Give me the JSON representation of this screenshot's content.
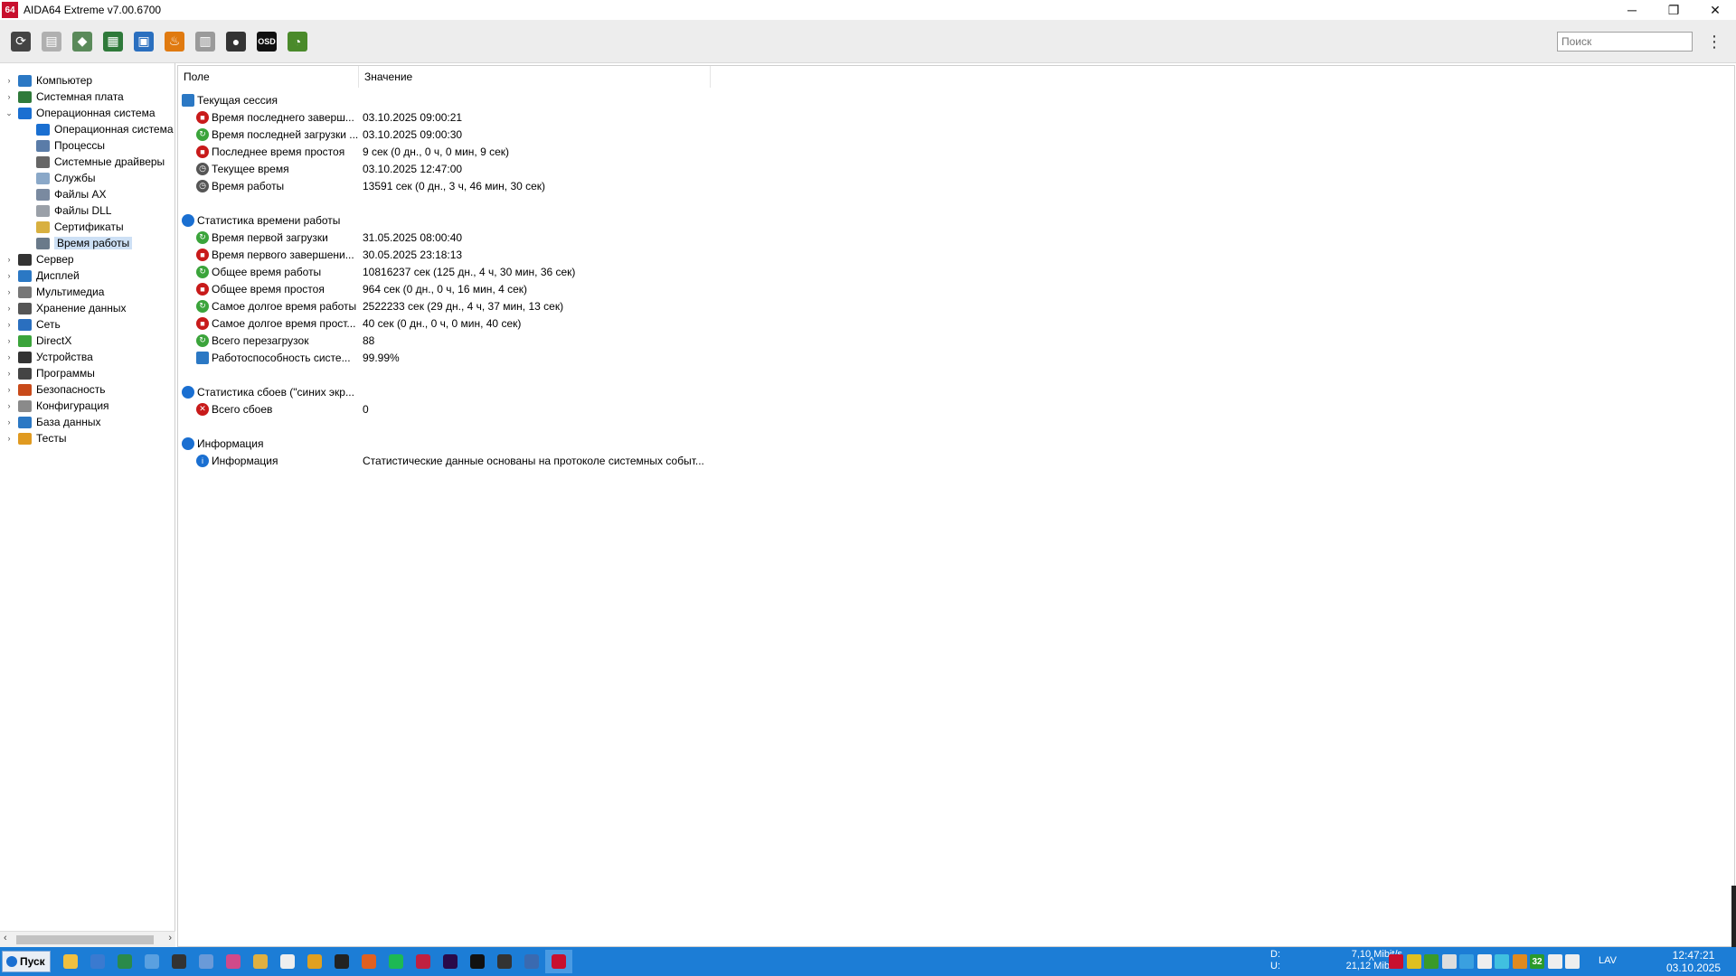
{
  "window": {
    "icon_text": "64",
    "title": "AIDA64 Extreme v7.00.6700",
    "min": "─",
    "restore": "❐",
    "close": "✕"
  },
  "toolbar": {
    "search_placeholder": "Поиск",
    "menu": "⋮",
    "buttons": [
      {
        "name": "refresh-icon",
        "glyph": "⟳",
        "color": "#444444"
      },
      {
        "name": "report-icon",
        "glyph": "▤",
        "color": "#b0b0b0"
      },
      {
        "name": "motherboard-icon",
        "glyph": "◆",
        "color": "#5a8a5a"
      },
      {
        "name": "memory-icon",
        "glyph": "▦",
        "color": "#2f7a3a"
      },
      {
        "name": "network-icon",
        "glyph": "▣",
        "color": "#2a6fbf"
      },
      {
        "name": "flame-icon",
        "glyph": "♨",
        "color": "#e07a10"
      },
      {
        "name": "benchmark-icon",
        "glyph": "▥",
        "color": "#9a9a9a"
      },
      {
        "name": "user-icon",
        "glyph": "●",
        "color": "#333333"
      },
      {
        "name": "osd-icon",
        "glyph": "OSD",
        "color": "#111111"
      },
      {
        "name": "gauge-icon",
        "glyph": "◔",
        "color": "#4a8a2a"
      }
    ]
  },
  "tree": {
    "items": [
      {
        "label": "Компьютер",
        "arrow": "›",
        "level": 0,
        "color": "#2b78c4",
        "icon": "computer-icon"
      },
      {
        "label": "Системная плата",
        "arrow": "›",
        "level": 0,
        "color": "#2f7a3a",
        "icon": "motherboard-icon"
      },
      {
        "label": "Операционная система",
        "arrow": "⌄",
        "level": 0,
        "color": "#1a6fd1",
        "icon": "windows-icon"
      },
      {
        "label": "Операционная система",
        "arrow": "",
        "level": 1,
        "color": "#1a6fd1",
        "icon": "windows-icon"
      },
      {
        "label": "Процессы",
        "arrow": "",
        "level": 1,
        "color": "#5a7ca8",
        "icon": "process-icon"
      },
      {
        "label": "Системные драйверы",
        "arrow": "",
        "level": 1,
        "color": "#666666",
        "icon": "driver-icon"
      },
      {
        "label": "Службы",
        "arrow": "",
        "level": 1,
        "color": "#8aa8c8",
        "icon": "services-icon"
      },
      {
        "label": "Файлы AX",
        "arrow": "",
        "level": 1,
        "color": "#7a8aa0",
        "icon": "ax-file-icon"
      },
      {
        "label": "Файлы DLL",
        "arrow": "",
        "level": 1,
        "color": "#9aa0a8",
        "icon": "dll-file-icon"
      },
      {
        "label": "Сертификаты",
        "arrow": "",
        "level": 1,
        "color": "#d8b040",
        "icon": "certificate-icon"
      },
      {
        "label": "Время работы",
        "arrow": "",
        "level": 1,
        "color": "#6a7a8a",
        "icon": "uptime-icon",
        "selected": true
      },
      {
        "label": "Сервер",
        "arrow": "›",
        "level": 0,
        "color": "#333333",
        "icon": "server-icon"
      },
      {
        "label": "Дисплей",
        "arrow": "›",
        "level": 0,
        "color": "#2b78c4",
        "icon": "display-icon"
      },
      {
        "label": "Мультимедиа",
        "arrow": "›",
        "level": 0,
        "color": "#777777",
        "icon": "multimedia-icon"
      },
      {
        "label": "Хранение данных",
        "arrow": "›",
        "level": 0,
        "color": "#555555",
        "icon": "storage-icon"
      },
      {
        "label": "Сеть",
        "arrow": "›",
        "level": 0,
        "color": "#2a6fbf",
        "icon": "network-icon"
      },
      {
        "label": "DirectX",
        "arrow": "›",
        "level": 0,
        "color": "#3ba43b",
        "icon": "directx-icon"
      },
      {
        "label": "Устройства",
        "arrow": "›",
        "level": 0,
        "color": "#333333",
        "icon": "devices-icon"
      },
      {
        "label": "Программы",
        "arrow": "›",
        "level": 0,
        "color": "#444444",
        "icon": "programs-icon"
      },
      {
        "label": "Безопасность",
        "arrow": "›",
        "level": 0,
        "color": "#c84a1a",
        "icon": "security-icon"
      },
      {
        "label": "Конфигурация",
        "arrow": "›",
        "level": 0,
        "color": "#8a8a8a",
        "icon": "config-icon"
      },
      {
        "label": "База данных",
        "arrow": "›",
        "level": 0,
        "color": "#2b78c4",
        "icon": "database-icon"
      },
      {
        "label": "Тесты",
        "arrow": "›",
        "level": 0,
        "color": "#e09a20",
        "icon": "tests-icon"
      }
    ],
    "scroll_left": "‹",
    "scroll_right": "›"
  },
  "panel": {
    "col_field": "Поле",
    "col_value": "Значение",
    "sections": [
      {
        "title": "Текущая сессия",
        "icon": "session-icon",
        "icolor": "scr",
        "rows": [
          {
            "field": "Время последнего заверш...",
            "value": "03.10.2025 09:00:21",
            "icolor": "red",
            "glyph": "■"
          },
          {
            "field": "Время последней загрузки ...",
            "value": "03.10.2025 09:00:30",
            "icolor": "grn",
            "glyph": "↻"
          },
          {
            "field": "Последнее время простоя",
            "value": "9 сек (0 дн., 0 ч, 0 мин, 9 сек)",
            "icolor": "red",
            "glyph": "■"
          },
          {
            "field": "Текущее время",
            "value": "03.10.2025 12:47:00",
            "icolor": "gry",
            "glyph": "◷"
          },
          {
            "field": "Время работы",
            "value": "13591 сек (0 дн., 3 ч, 46 мин, 30 сек)",
            "icolor": "gry",
            "glyph": "◷"
          }
        ]
      },
      {
        "title": "Статистика времени работы",
        "icon": "stats-icon",
        "icolor": "blu",
        "rows": [
          {
            "field": "Время первой загрузки",
            "value": "31.05.2025 08:00:40",
            "icolor": "grn",
            "glyph": "↻"
          },
          {
            "field": "Время первого завершени...",
            "value": "30.05.2025 23:18:13",
            "icolor": "red",
            "glyph": "■"
          },
          {
            "field": "Общее время работы",
            "value": "10816237 сек (125 дн., 4 ч, 30 мин, 36 сек)",
            "icolor": "grn",
            "glyph": "↻"
          },
          {
            "field": "Общее время простоя",
            "value": "964 сек (0 дн., 0 ч, 16 мин, 4 сек)",
            "icolor": "red",
            "glyph": "■"
          },
          {
            "field": "Самое долгое время работы",
            "value": "2522233 сек (29 дн., 4 ч, 37 мин, 13 сек)",
            "icolor": "grn",
            "glyph": "↻"
          },
          {
            "field": "Самое долгое время прост...",
            "value": "40 сек (0 дн., 0 ч, 0 мин, 40 сек)",
            "icolor": "red",
            "glyph": "■"
          },
          {
            "field": "Всего перезагрузок",
            "value": "88",
            "icolor": "grn",
            "glyph": "↻"
          },
          {
            "field": "Работоспособность систе...",
            "value": "99.99%",
            "icolor": "scr",
            "glyph": ""
          }
        ]
      },
      {
        "title": "Статистика сбоев (\"синих экр...",
        "icon": "crash-stats-icon",
        "icolor": "blu",
        "rows": [
          {
            "field": "Всего сбоев",
            "value": "0",
            "icolor": "red",
            "glyph": "✕"
          }
        ]
      },
      {
        "title": "Информация",
        "icon": "info-icon",
        "icolor": "blu",
        "rows": [
          {
            "field": "Информация",
            "value": "Статистические данные основаны на протоколе системных событ...",
            "icolor": "blu",
            "glyph": "i"
          }
        ]
      }
    ]
  },
  "taskbar": {
    "start_label": "Пуск",
    "apps": [
      {
        "name": "explorer-icon",
        "color": "#f0c040"
      },
      {
        "name": "app-blue-circle-icon",
        "color": "#3a7ad0"
      },
      {
        "name": "app-excel-icon",
        "color": "#2a8a4a"
      },
      {
        "name": "app-disc-icon",
        "color": "#5aa0e0"
      },
      {
        "name": "app-car-icon",
        "color": "#333333"
      },
      {
        "name": "app-globe-icon",
        "color": "#6a9ad8"
      },
      {
        "name": "app-image-icon",
        "color": "#d04a8a"
      },
      {
        "name": "app-folder-icon",
        "color": "#e0b040"
      },
      {
        "name": "app-cursor-icon",
        "color": "#eeeeee"
      },
      {
        "name": "chrome-icon",
        "color": "#e0a020"
      },
      {
        "name": "app-imdb-icon",
        "color": "#222222"
      },
      {
        "name": "firefox-icon",
        "color": "#e06020"
      },
      {
        "name": "spotify-icon",
        "color": "#1db954"
      },
      {
        "name": "app-red-icon",
        "color": "#c02040"
      },
      {
        "name": "premiere-icon",
        "color": "#2a0a4a"
      },
      {
        "name": "tiktok-icon",
        "color": "#111111"
      },
      {
        "name": "app-tools-icon",
        "color": "#333333"
      },
      {
        "name": "app-blue-icon",
        "color": "#3a6ab0"
      },
      {
        "name": "aida64-icon",
        "color": "#c8102e"
      }
    ],
    "net_d_label": "D:",
    "net_u_label": "U:",
    "net_d_value": "7,10 Mibit/s",
    "net_u_value": "21,12 Mibit/s",
    "tray_chevron": "^",
    "tray": [
      {
        "name": "aida64-tray-icon",
        "color": "#c8102e"
      },
      {
        "name": "shield-tray-icon",
        "color": "#e0c020"
      },
      {
        "name": "nvidia-tray-icon",
        "color": "#3a9a2a"
      },
      {
        "name": "monitor-tray-icon",
        "color": "#dddddd"
      },
      {
        "name": "telegram-tray-icon",
        "color": "#3aa0e0"
      },
      {
        "name": "usb-tray-icon",
        "color": "#eeeeee"
      },
      {
        "name": "chat-tray-icon",
        "color": "#40c0e0"
      },
      {
        "name": "color-tray-icon",
        "color": "#e08a20"
      },
      {
        "name": "temp-tray-icon",
        "color": "#2a9a2a"
      },
      {
        "name": "network-tray-icon",
        "color": "#eeeeee"
      },
      {
        "name": "volume-tray-icon",
        "color": "#eeeeee"
      }
    ],
    "temp_badge": "32",
    "lang": "LAV",
    "time": "12:47:21",
    "date": "03.10.2025"
  }
}
